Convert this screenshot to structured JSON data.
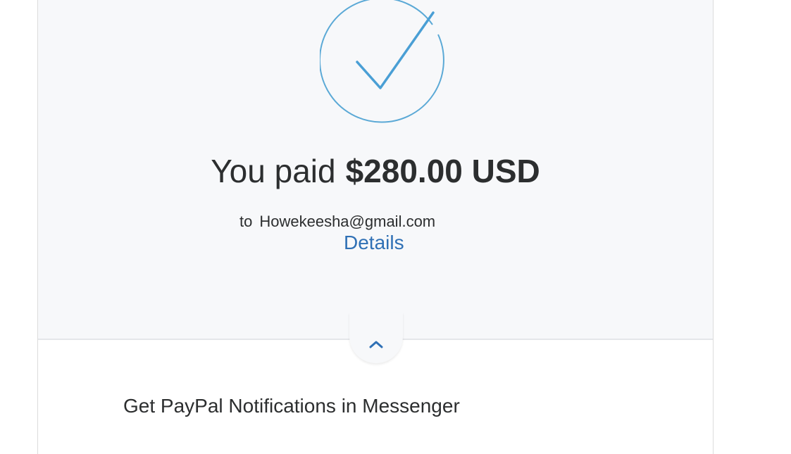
{
  "payment": {
    "paid_label": "You paid",
    "amount": "$280.00 USD",
    "to_word": "to",
    "recipient": "Howekeesha@gmail.com",
    "details_link": "Details"
  },
  "icons": {
    "success": "check-circle-icon",
    "collapse": "chevron-up-icon"
  },
  "notifications": {
    "title": "Get PayPal Notifications in Messenger"
  },
  "colors": {
    "accent": "#4a9fd5",
    "link": "#2f70b5",
    "text": "#2c2e2f",
    "panel_bg": "#f7f8fa"
  }
}
